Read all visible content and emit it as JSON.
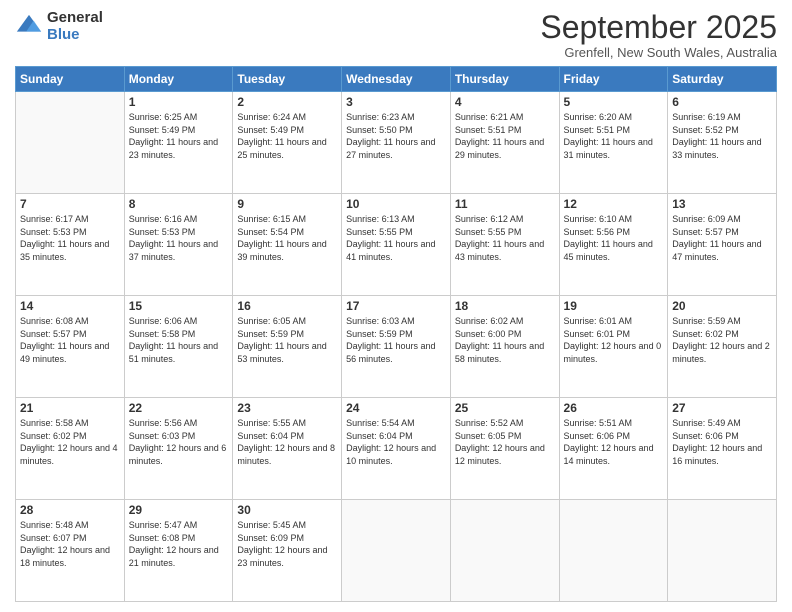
{
  "logo": {
    "general": "General",
    "blue": "Blue"
  },
  "header": {
    "month": "September 2025",
    "location": "Grenfell, New South Wales, Australia"
  },
  "weekdays": [
    "Sunday",
    "Monday",
    "Tuesday",
    "Wednesday",
    "Thursday",
    "Friday",
    "Saturday"
  ],
  "weeks": [
    [
      {
        "day": "",
        "sunrise": "",
        "sunset": "",
        "daylight": ""
      },
      {
        "day": "1",
        "sunrise": "Sunrise: 6:25 AM",
        "sunset": "Sunset: 5:49 PM",
        "daylight": "Daylight: 11 hours and 23 minutes."
      },
      {
        "day": "2",
        "sunrise": "Sunrise: 6:24 AM",
        "sunset": "Sunset: 5:49 PM",
        "daylight": "Daylight: 11 hours and 25 minutes."
      },
      {
        "day": "3",
        "sunrise": "Sunrise: 6:23 AM",
        "sunset": "Sunset: 5:50 PM",
        "daylight": "Daylight: 11 hours and 27 minutes."
      },
      {
        "day": "4",
        "sunrise": "Sunrise: 6:21 AM",
        "sunset": "Sunset: 5:51 PM",
        "daylight": "Daylight: 11 hours and 29 minutes."
      },
      {
        "day": "5",
        "sunrise": "Sunrise: 6:20 AM",
        "sunset": "Sunset: 5:51 PM",
        "daylight": "Daylight: 11 hours and 31 minutes."
      },
      {
        "day": "6",
        "sunrise": "Sunrise: 6:19 AM",
        "sunset": "Sunset: 5:52 PM",
        "daylight": "Daylight: 11 hours and 33 minutes."
      }
    ],
    [
      {
        "day": "7",
        "sunrise": "Sunrise: 6:17 AM",
        "sunset": "Sunset: 5:53 PM",
        "daylight": "Daylight: 11 hours and 35 minutes."
      },
      {
        "day": "8",
        "sunrise": "Sunrise: 6:16 AM",
        "sunset": "Sunset: 5:53 PM",
        "daylight": "Daylight: 11 hours and 37 minutes."
      },
      {
        "day": "9",
        "sunrise": "Sunrise: 6:15 AM",
        "sunset": "Sunset: 5:54 PM",
        "daylight": "Daylight: 11 hours and 39 minutes."
      },
      {
        "day": "10",
        "sunrise": "Sunrise: 6:13 AM",
        "sunset": "Sunset: 5:55 PM",
        "daylight": "Daylight: 11 hours and 41 minutes."
      },
      {
        "day": "11",
        "sunrise": "Sunrise: 6:12 AM",
        "sunset": "Sunset: 5:55 PM",
        "daylight": "Daylight: 11 hours and 43 minutes."
      },
      {
        "day": "12",
        "sunrise": "Sunrise: 6:10 AM",
        "sunset": "Sunset: 5:56 PM",
        "daylight": "Daylight: 11 hours and 45 minutes."
      },
      {
        "day": "13",
        "sunrise": "Sunrise: 6:09 AM",
        "sunset": "Sunset: 5:57 PM",
        "daylight": "Daylight: 11 hours and 47 minutes."
      }
    ],
    [
      {
        "day": "14",
        "sunrise": "Sunrise: 6:08 AM",
        "sunset": "Sunset: 5:57 PM",
        "daylight": "Daylight: 11 hours and 49 minutes."
      },
      {
        "day": "15",
        "sunrise": "Sunrise: 6:06 AM",
        "sunset": "Sunset: 5:58 PM",
        "daylight": "Daylight: 11 hours and 51 minutes."
      },
      {
        "day": "16",
        "sunrise": "Sunrise: 6:05 AM",
        "sunset": "Sunset: 5:59 PM",
        "daylight": "Daylight: 11 hours and 53 minutes."
      },
      {
        "day": "17",
        "sunrise": "Sunrise: 6:03 AM",
        "sunset": "Sunset: 5:59 PM",
        "daylight": "Daylight: 11 hours and 56 minutes."
      },
      {
        "day": "18",
        "sunrise": "Sunrise: 6:02 AM",
        "sunset": "Sunset: 6:00 PM",
        "daylight": "Daylight: 11 hours and 58 minutes."
      },
      {
        "day": "19",
        "sunrise": "Sunrise: 6:01 AM",
        "sunset": "Sunset: 6:01 PM",
        "daylight": "Daylight: 12 hours and 0 minutes."
      },
      {
        "day": "20",
        "sunrise": "Sunrise: 5:59 AM",
        "sunset": "Sunset: 6:02 PM",
        "daylight": "Daylight: 12 hours and 2 minutes."
      }
    ],
    [
      {
        "day": "21",
        "sunrise": "Sunrise: 5:58 AM",
        "sunset": "Sunset: 6:02 PM",
        "daylight": "Daylight: 12 hours and 4 minutes."
      },
      {
        "day": "22",
        "sunrise": "Sunrise: 5:56 AM",
        "sunset": "Sunset: 6:03 PM",
        "daylight": "Daylight: 12 hours and 6 minutes."
      },
      {
        "day": "23",
        "sunrise": "Sunrise: 5:55 AM",
        "sunset": "Sunset: 6:04 PM",
        "daylight": "Daylight: 12 hours and 8 minutes."
      },
      {
        "day": "24",
        "sunrise": "Sunrise: 5:54 AM",
        "sunset": "Sunset: 6:04 PM",
        "daylight": "Daylight: 12 hours and 10 minutes."
      },
      {
        "day": "25",
        "sunrise": "Sunrise: 5:52 AM",
        "sunset": "Sunset: 6:05 PM",
        "daylight": "Daylight: 12 hours and 12 minutes."
      },
      {
        "day": "26",
        "sunrise": "Sunrise: 5:51 AM",
        "sunset": "Sunset: 6:06 PM",
        "daylight": "Daylight: 12 hours and 14 minutes."
      },
      {
        "day": "27",
        "sunrise": "Sunrise: 5:49 AM",
        "sunset": "Sunset: 6:06 PM",
        "daylight": "Daylight: 12 hours and 16 minutes."
      }
    ],
    [
      {
        "day": "28",
        "sunrise": "Sunrise: 5:48 AM",
        "sunset": "Sunset: 6:07 PM",
        "daylight": "Daylight: 12 hours and 18 minutes."
      },
      {
        "day": "29",
        "sunrise": "Sunrise: 5:47 AM",
        "sunset": "Sunset: 6:08 PM",
        "daylight": "Daylight: 12 hours and 21 minutes."
      },
      {
        "day": "30",
        "sunrise": "Sunrise: 5:45 AM",
        "sunset": "Sunset: 6:09 PM",
        "daylight": "Daylight: 12 hours and 23 minutes."
      },
      {
        "day": "",
        "sunrise": "",
        "sunset": "",
        "daylight": ""
      },
      {
        "day": "",
        "sunrise": "",
        "sunset": "",
        "daylight": ""
      },
      {
        "day": "",
        "sunrise": "",
        "sunset": "",
        "daylight": ""
      },
      {
        "day": "",
        "sunrise": "",
        "sunset": "",
        "daylight": ""
      }
    ]
  ]
}
